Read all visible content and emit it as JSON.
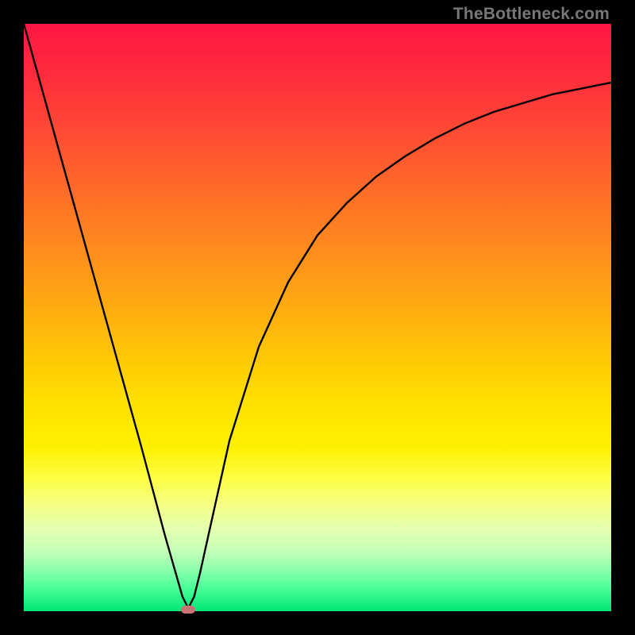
{
  "watermark": "TheBottleneck.com",
  "chart_data": {
    "type": "line",
    "title": "",
    "xlabel": "",
    "ylabel": "",
    "xlim": [
      0,
      1
    ],
    "ylim": [
      0,
      1
    ],
    "series": [
      {
        "name": "curve",
        "x": [
          0.0,
          0.05,
          0.1,
          0.15,
          0.2,
          0.24,
          0.26,
          0.27,
          0.28,
          0.29,
          0.3,
          0.32,
          0.35,
          0.4,
          0.45,
          0.5,
          0.55,
          0.6,
          0.65,
          0.7,
          0.75,
          0.8,
          0.85,
          0.9,
          0.95,
          1.0
        ],
        "y": [
          1.0,
          0.82,
          0.64,
          0.46,
          0.28,
          0.13,
          0.06,
          0.025,
          0.005,
          0.025,
          0.065,
          0.155,
          0.29,
          0.45,
          0.56,
          0.64,
          0.695,
          0.74,
          0.775,
          0.805,
          0.83,
          0.85,
          0.865,
          0.88,
          0.89,
          0.9
        ]
      }
    ],
    "marker": {
      "x": 0.28,
      "y": 0.0
    },
    "annotations": []
  },
  "colors": {
    "frame": "#000000",
    "curve": "#000000",
    "marker": "#c87373",
    "watermark": "#777777"
  }
}
